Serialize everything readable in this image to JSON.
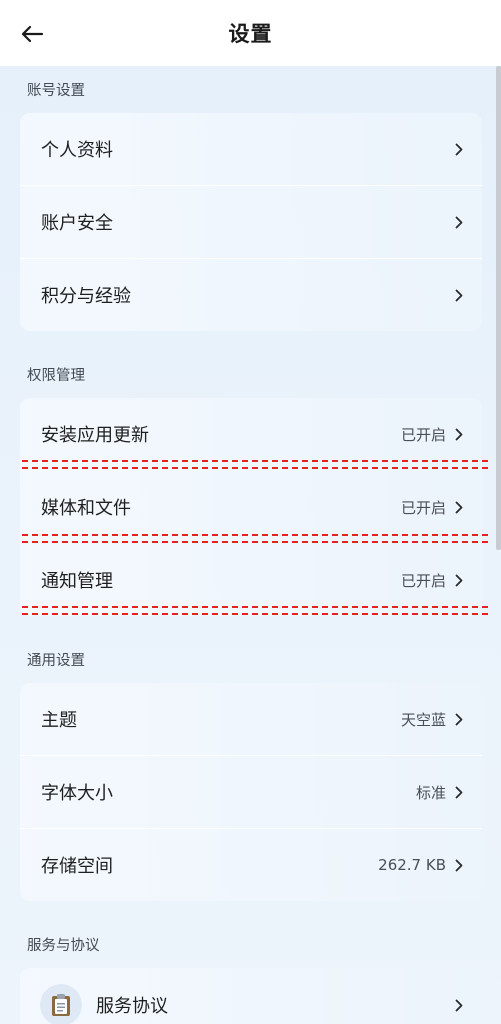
{
  "header": {
    "title": "设置"
  },
  "sections": {
    "account": {
      "title": "账号设置",
      "items": [
        {
          "label": "个人资料"
        },
        {
          "label": "账户安全"
        },
        {
          "label": "积分与经验"
        }
      ]
    },
    "permissions": {
      "title": "权限管理",
      "items": [
        {
          "label": "安装应用更新",
          "value": "已开启"
        },
        {
          "label": "媒体和文件",
          "value": "已开启"
        },
        {
          "label": "通知管理",
          "value": "已开启"
        }
      ]
    },
    "general": {
      "title": "通用设置",
      "items": [
        {
          "label": "主题",
          "value": "天空蓝"
        },
        {
          "label": "字体大小",
          "value": "标准"
        },
        {
          "label": "存储空间",
          "value": "262.7 KB"
        }
      ]
    },
    "service": {
      "title": "服务与协议",
      "items": [
        {
          "label": "服务协议",
          "icon": "clipboard-icon"
        }
      ]
    }
  },
  "colors": {
    "annotation": "#e5231e",
    "background": "#e8f1fb"
  }
}
